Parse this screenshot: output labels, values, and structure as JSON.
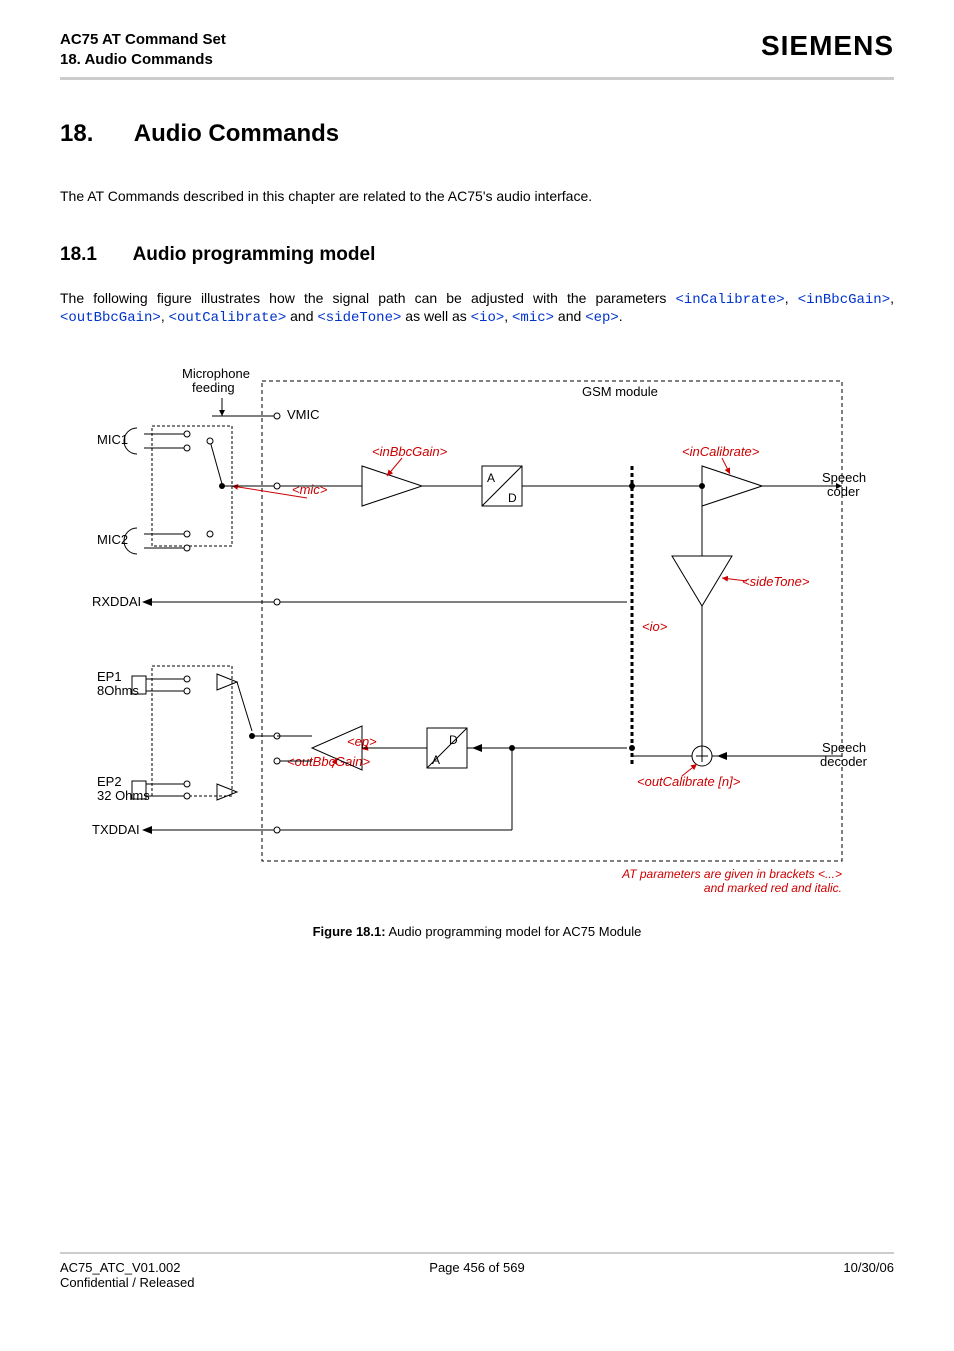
{
  "header": {
    "title": "AC75 AT Command Set",
    "subtitle": "18. Audio Commands",
    "brand": "SIEMENS"
  },
  "chapter": {
    "number": "18.",
    "title": "Audio Commands",
    "intro": "The AT Commands described in this chapter are related to the AC75's audio interface."
  },
  "section": {
    "number": "18.1",
    "title": "Audio programming model",
    "desc_lead": "The following figure illustrates how the signal path can be adjusted with the parameters ",
    "params": {
      "p1": "<inCalibrate>",
      "p2": "<inBbcGain>",
      "p3": "<outBbcGain>",
      "p4": "<outCalibrate>",
      "and": " and ",
      "p5": "<sideTone>",
      "aswell": " as well as ",
      "p6": "<io>",
      "p7": "<mic>",
      "p8": "<ep>",
      "comma": ", ",
      "period": "."
    }
  },
  "figure": {
    "labels": {
      "mic_feed": "Microphone",
      "mic_feed2": "feeding",
      "vmic": "VMIC",
      "gsm": "GSM module",
      "mic1": "MIC1",
      "mic2": "MIC2",
      "rxddai": "RXDDAI",
      "ep1": "EP1",
      "ep1b": "8Ohms",
      "ep2": "EP2",
      "ep2b": "32 Ohms",
      "txddai": "TXDDAI",
      "ad_A": "A",
      "ad_D": "D",
      "da_D": "D",
      "da_A": "A",
      "speech_coder": "Speech",
      "speech_coder2": "coder",
      "speech_decoder": "Speech",
      "speech_decoder2": "decoder",
      "param_inBbcGain": "<inBbcGain>",
      "param_inCalibrate": "<inCalibrate>",
      "param_mic": "<mic>",
      "param_sideTone": "<sideTone>",
      "param_io": "<io>",
      "param_ep": "<ep>",
      "param_outBbcGain": "<outBbcGain>",
      "param_outCalibrate": "<outCalibrate [n]>",
      "note1": "AT parameters are given in brackets <...>",
      "note2": "and marked red and italic."
    },
    "caption_b": "Figure 18.1:",
    "caption": " Audio programming model for AC75 Module"
  },
  "footer": {
    "left1": "AC75_ATC_V01.002",
    "left2": "Confidential / Released",
    "center": "Page 456 of 569",
    "right": "10/30/06"
  }
}
